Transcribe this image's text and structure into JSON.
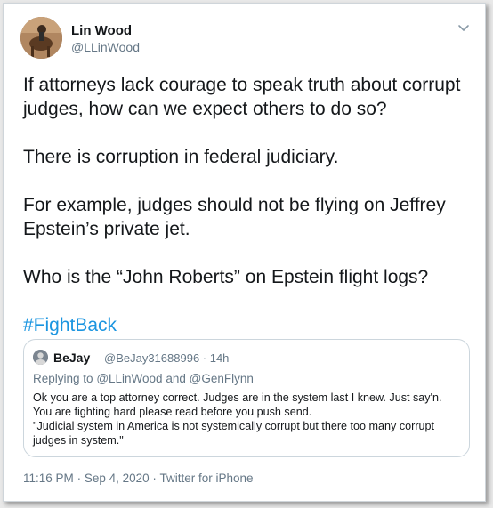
{
  "author": {
    "name": "Lin Wood",
    "handle": "@LLinWood"
  },
  "tweet": {
    "paragraphs": [
      "If attorneys lack courage to speak truth about corrupt judges, how can we expect others to do so?",
      "There is corruption in federal judiciary.",
      "For example, judges should not be flying on Jeffrey Epstein’s private jet.",
      "Who is the “John Roberts” on Epstein flight logs?"
    ],
    "hashtag": "#FightBack"
  },
  "quoted": {
    "name": "BeJay",
    "handle_time": "@BeJay31688996 · 14h",
    "replying_prefix": "Replying to",
    "mention1": "@LLinWood",
    "and": "and",
    "mention2": "@GenFlynn",
    "lines": [
      "Ok you are a top attorney correct.  Judges are in the system last I knew.  Just say'n.",
      "You are fighting hard please read before you push send.",
      "\"Judicial system in America is not systemically corrupt but there too many corrupt",
      "judges in system.\""
    ]
  },
  "footer": {
    "time": "11:16 PM",
    "date": "Sep 4, 2020",
    "source": "Twitter for iPhone",
    "separator": "·"
  },
  "colors": {
    "text": "#14171a",
    "secondary": "#657786",
    "link": "#1b95e0",
    "border": "#ccd6dd"
  },
  "icons": {
    "caret": "chevron-down-icon"
  }
}
